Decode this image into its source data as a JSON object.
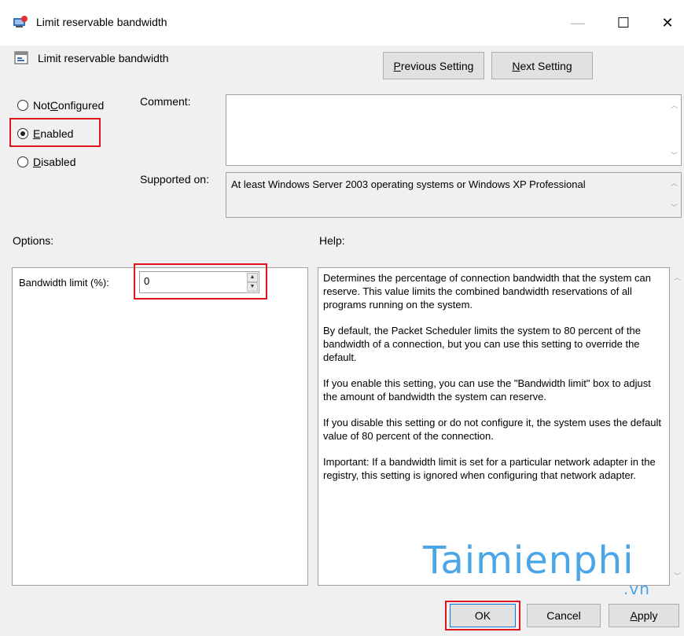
{
  "window": {
    "title": "Limit reservable bandwidth",
    "minimize": "—",
    "maximize": "☐",
    "close": "✕"
  },
  "setting_name": "Limit reservable bandwidth",
  "nav": {
    "previous_pre": "",
    "previous_ul": "P",
    "previous_post": "revious Setting",
    "next_pre": "",
    "next_ul": "N",
    "next_post": "ext Setting"
  },
  "state": {
    "not_configured_pre": "Not ",
    "not_configured_ul": "C",
    "not_configured_post": "onfigured",
    "enabled_ul": "E",
    "enabled_post": "nabled",
    "disabled_ul": "D",
    "disabled_post": "isabled",
    "selected": "enabled"
  },
  "comment_label": "Comment:",
  "comment_value": "",
  "supported_label": "Supported on:",
  "supported_value": "At least Windows Server 2003 operating systems or Windows XP Professional",
  "options_label": "Options:",
  "help_label": "Help:",
  "bandwidth_label": "Bandwidth limit (%):",
  "bandwidth_value": "0",
  "help_paragraphs": [
    "Determines the percentage of connection bandwidth that the system can reserve. This value limits the combined bandwidth reservations of all programs running on the system.",
    "By default, the Packet Scheduler limits the system to 80 percent of the bandwidth of a connection, but you can use this setting to override the default.",
    "If you enable this setting, you can use the \"Bandwidth limit\" box to adjust the amount of bandwidth the system can reserve.",
    "If you disable this setting or do not configure it, the system uses the default value of 80 percent of the connection.",
    "Important: If a bandwidth limit is set for a particular network adapter in the registry, this setting is ignored when configuring that network adapter."
  ],
  "buttons": {
    "ok": "OK",
    "cancel": "Cancel",
    "apply_ul": "A",
    "apply_post": "pply"
  },
  "watermark": {
    "main": "Taimienphi",
    "suffix": ".vn"
  },
  "colors": {
    "highlight": "#e0141e",
    "watermark": "#4aa6e6"
  }
}
